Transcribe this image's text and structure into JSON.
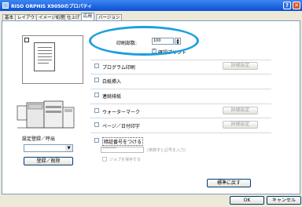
{
  "window": {
    "title": "RISO ORPHIS X9050のプロパティ",
    "help_glyph": "?",
    "close_glyph": "✕"
  },
  "tabs": [
    {
      "label": "基本"
    },
    {
      "label": "レイアウト"
    },
    {
      "label": "イメージ処理"
    },
    {
      "label": "仕上げ"
    },
    {
      "label": "応用"
    },
    {
      "label": "バージョン"
    }
  ],
  "copies": {
    "label": "印刷部数:",
    "value": "100",
    "confirm_print_label": "確認プリント",
    "confirm_print_checked": true
  },
  "options": [
    {
      "label": "プログラム印刷",
      "checked": false,
      "button": "詳細設定"
    },
    {
      "label": "白紙挿入",
      "checked": false,
      "button": ""
    },
    {
      "label": "連続排紙",
      "checked": false,
      "button": ""
    },
    {
      "label": "ウォーターマーク",
      "checked": false,
      "button": "詳細設定"
    },
    {
      "label": "ページ／日付印字",
      "checked": false,
      "button": "詳細設定"
    },
    {
      "label": "暗証番号をつける",
      "checked": false,
      "button": ""
    }
  ],
  "pin": {
    "value": "********",
    "hint": "(英数字と記号を入力)",
    "sub_option_label": "ジョブを保存する"
  },
  "preset": {
    "label": "設定登録／呼出",
    "register_button": "登録／削除"
  },
  "buttons": {
    "restore": "標準に戻す",
    "ok": "OK",
    "cancel": "キャンセル"
  },
  "colors": {
    "highlight_ellipse": "#1a9fe0",
    "titlebar": "#0a4fd6"
  }
}
